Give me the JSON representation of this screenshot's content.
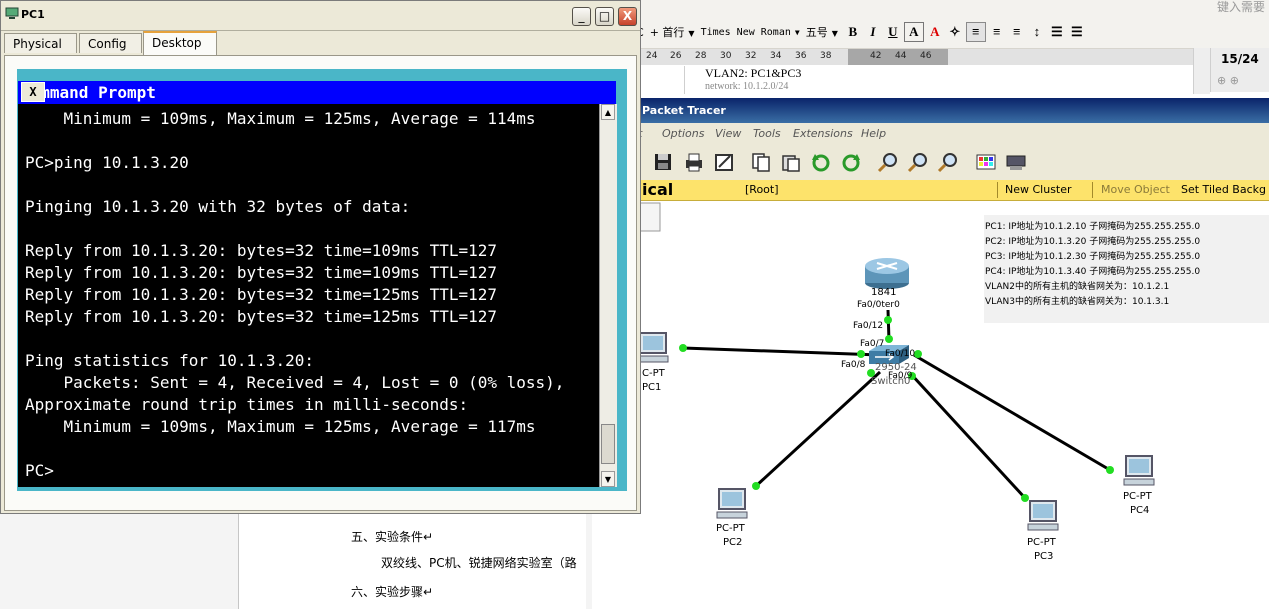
{
  "word_processor": {
    "search_hint": "键入需要",
    "font_row": {
      "partial_label": "C",
      "first_line_indent": "+ 首行",
      "font_name": "Times New Roman",
      "font_size": "五号",
      "bold": "B",
      "italic": "I",
      "underline": "U",
      "char_shade": "A"
    },
    "ruler_ticks": [
      "24",
      "26",
      "28",
      "30",
      "32",
      "34",
      "36",
      "38",
      "42",
      "44",
      "46"
    ],
    "page_counter": "15/24",
    "doc_top_text": "VLAN2: PC1&PC3",
    "doc_top_partial": "network: 10.1.2.0/24",
    "lower_lines": [
      "五、实验条件↵",
      "双绞线、PC机、锐捷网络实验室（路",
      "六、实验步骤↵"
    ]
  },
  "packet_tracer": {
    "title": "Packet Tracer",
    "menu": [
      "t",
      "Options",
      "View",
      "Tools",
      "Extensions",
      "Help"
    ],
    "nav": {
      "mode": "ical",
      "root": "[Root]",
      "new_cluster": "New Cluster",
      "move_object": "Move Object",
      "set_tiled": "Set Tiled Backg"
    },
    "note_lines": [
      "PC1:  IP地址为10.1.2.10 子网掩码为255.255.255.0",
      "PC2:  IP地址为10.1.3.20 子网掩码为255.255.255.0",
      "PC3:  IP地址为10.1.2.30 子网掩码为255.255.255.0",
      "PC4:  IP地址为10.1.3.40 子网掩码为255.255.255.0",
      "VLAN2中的所有主机的缺省网关为：10.1.2.1",
      "VLAN3中的所有主机的缺省网关为：10.1.3.1"
    ],
    "devices": {
      "router": {
        "model": "1841",
        "port": "Fa0/0"
      },
      "router_port_suffix": "ter0",
      "switch": {
        "model": "2950-24",
        "name": "Switch0"
      },
      "pc1": {
        "type": "C-PT",
        "name": "PC1"
      },
      "pc2": {
        "type": "PC-PT",
        "name": "PC2"
      },
      "pc3": {
        "type": "PC-PT",
        "name": "PC3"
      },
      "pc4": {
        "type": "PC-PT",
        "name": "PC4"
      }
    },
    "ports": {
      "sw_to_router": "Fa0/12",
      "sw_to_pc1": "Fa0/7",
      "sw_to_pc2": "Fa0/8",
      "sw_to_pc3": "Fa0/9",
      "sw_to_pc4": "Fa0/10"
    }
  },
  "pc1_window": {
    "title": "PC1",
    "tabs": [
      "Physical",
      "Config",
      "Desktop"
    ],
    "active_tab": "Desktop",
    "controls": {
      "minimize": "_",
      "maximize": "□",
      "close": "X"
    },
    "command_prompt": {
      "title": "Command Prompt",
      "close": "X",
      "lines": [
        "    Minimum = 109ms, Maximum = 125ms, Average = 114ms",
        "",
        "PC>ping 10.1.3.20",
        "",
        "Pinging 10.1.3.20 with 32 bytes of data:",
        "",
        "Reply from 10.1.3.20: bytes=32 time=109ms TTL=127",
        "Reply from 10.1.3.20: bytes=32 time=109ms TTL=127",
        "Reply from 10.1.3.20: bytes=32 time=125ms TTL=127",
        "Reply from 10.1.3.20: bytes=32 time=125ms TTL=127",
        "",
        "Ping statistics for 10.1.3.20:",
        "    Packets: Sent = 4, Received = 4, Lost = 0 (0% loss),",
        "Approximate round trip times in milli-seconds:",
        "    Minimum = 109ms, Maximum = 125ms, Average = 117ms",
        "",
        "PC>"
      ]
    }
  },
  "colors": {
    "cmd_title_bg": "#0000ff",
    "pc1_frame_accent": "#4ab6c8",
    "link": "#000000",
    "port_up": "#22dd22",
    "pt_nav_bar": "#fde36b"
  }
}
